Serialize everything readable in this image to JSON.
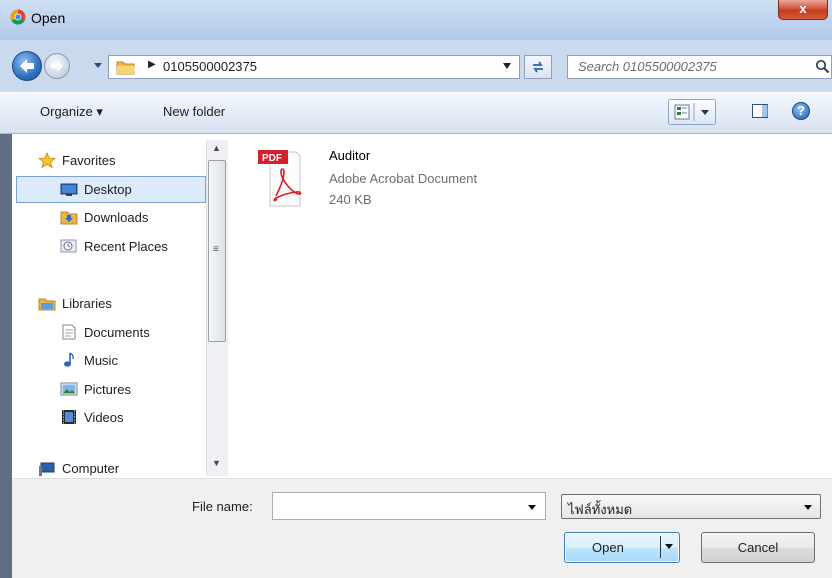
{
  "window": {
    "title": "Open",
    "close_label": "x"
  },
  "address": {
    "path": "0105500002375",
    "search_placeholder": "Search 0105500002375"
  },
  "toolbar": {
    "organize_label": "Organize ▾",
    "new_folder_label": "New folder"
  },
  "nav": {
    "favorites": {
      "label": "Favorites",
      "items": [
        {
          "label": "Desktop",
          "icon": "desktop-icon"
        },
        {
          "label": "Downloads",
          "icon": "downloads-folder-icon"
        },
        {
          "label": "Recent Places",
          "icon": "recent-places-icon"
        }
      ]
    },
    "libraries": {
      "label": "Libraries",
      "items": [
        {
          "label": "Documents",
          "icon": "documents-icon"
        },
        {
          "label": "Music",
          "icon": "music-icon"
        },
        {
          "label": "Pictures",
          "icon": "pictures-icon"
        },
        {
          "label": "Videos",
          "icon": "videos-icon"
        }
      ]
    },
    "computer": {
      "label": "Computer"
    }
  },
  "files": [
    {
      "name": "Auditor",
      "type": "Adobe Acrobat Document",
      "size": "240 KB",
      "icon": "pdf-icon",
      "badge": "PDF"
    }
  ],
  "footer": {
    "file_name_label": "File name:",
    "file_name_value": "",
    "filter_value": "ไฟล์ทั้งหมด",
    "open_label": "Open",
    "cancel_label": "Cancel"
  },
  "colors": {
    "selection": "#dcebfc",
    "selection_border": "#7da2ce",
    "pdf_red": "#d4202a"
  }
}
